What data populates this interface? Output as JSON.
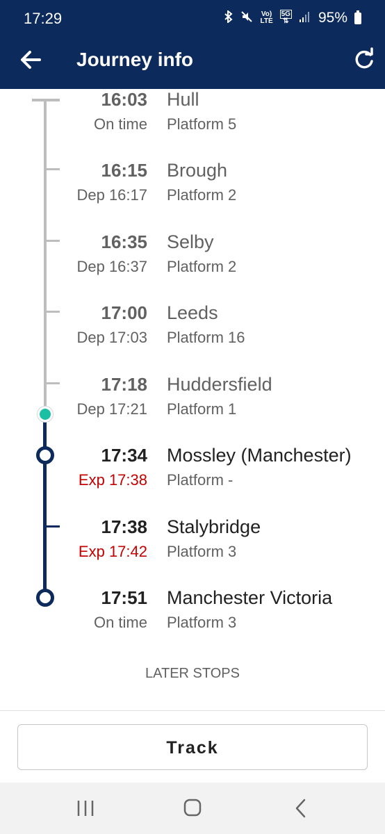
{
  "status_bar": {
    "time": "17:29",
    "network_top": "Vo)",
    "network_bottom": "LTE",
    "net5g": "5G",
    "battery": "95%"
  },
  "app_bar": {
    "title": "Journey info"
  },
  "stops": [
    {
      "time": "16:03",
      "status": "On time",
      "name": "Hull",
      "platform": "Platform 5"
    },
    {
      "time": "16:15",
      "status": "Dep 16:17",
      "name": "Brough",
      "platform": "Platform 2"
    },
    {
      "time": "16:35",
      "status": "Dep 16:37",
      "name": "Selby",
      "platform": "Platform 2"
    },
    {
      "time": "17:00",
      "status": "Dep 17:03",
      "name": "Leeds",
      "platform": "Platform 16"
    },
    {
      "time": "17:18",
      "status": "Dep 17:21",
      "name": "Huddersfield",
      "platform": "Platform 1"
    },
    {
      "time": "17:34",
      "status": "Exp 17:38",
      "name": "Mossley (Manchester)",
      "platform": "Platform -"
    },
    {
      "time": "17:38",
      "status": "Exp 17:42",
      "name": "Stalybridge",
      "platform": "Platform 3"
    },
    {
      "time": "17:51",
      "status": "On time",
      "name": "Manchester Victoria",
      "platform": "Platform 3"
    }
  ],
  "later_stops_label": "LATER STOPS",
  "track_label": "Track",
  "colors": {
    "header": "#0c2a5c",
    "current_dot": "#1bbfa4",
    "late": "#c40000"
  }
}
